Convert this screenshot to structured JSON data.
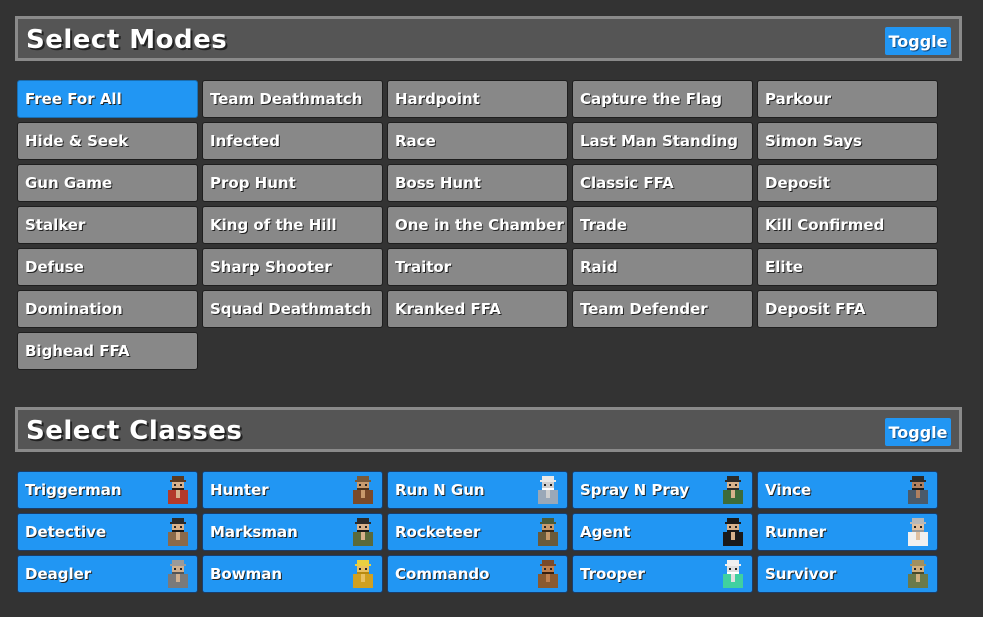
{
  "modes_section": {
    "title": "Select Modes",
    "toggle_label": "Toggle",
    "selected_index": 0,
    "items": [
      "Free For All",
      "Team Deathmatch",
      "Hardpoint",
      "Capture the Flag",
      "Parkour",
      "Hide & Seek",
      "Infected",
      "Race",
      "Last Man Standing",
      "Simon Says",
      "Gun Game",
      "Prop Hunt",
      "Boss Hunt",
      "Classic FFA",
      "Deposit",
      "Stalker",
      "King of the Hill",
      "One in the Chamber",
      "Trade",
      "Kill Confirmed",
      "Defuse",
      "Sharp Shooter",
      "Traitor",
      "Raid",
      "Elite",
      "Domination",
      "Squad Deathmatch",
      "Kranked FFA",
      "Team Defender",
      "Deposit FFA",
      "Bighead FFA"
    ]
  },
  "classes_section": {
    "title": "Select Classes",
    "toggle_label": "Toggle",
    "items": [
      {
        "label": "Triggerman",
        "icon": "triggerman-avatar-icon"
      },
      {
        "label": "Hunter",
        "icon": "hunter-avatar-icon"
      },
      {
        "label": "Run N Gun",
        "icon": "run-n-gun-avatar-icon"
      },
      {
        "label": "Spray N Pray",
        "icon": "spray-n-pray-avatar-icon"
      },
      {
        "label": "Vince",
        "icon": "vince-avatar-icon"
      },
      {
        "label": "Detective",
        "icon": "detective-avatar-icon"
      },
      {
        "label": "Marksman",
        "icon": "marksman-avatar-icon"
      },
      {
        "label": "Rocketeer",
        "icon": "rocketeer-avatar-icon"
      },
      {
        "label": "Agent",
        "icon": "agent-avatar-icon"
      },
      {
        "label": "Runner",
        "icon": "runner-avatar-icon"
      },
      {
        "label": "Deagler",
        "icon": "deagler-avatar-icon"
      },
      {
        "label": "Bowman",
        "icon": "bowman-avatar-icon"
      },
      {
        "label": "Commando",
        "icon": "commando-avatar-icon"
      },
      {
        "label": "Trooper",
        "icon": "trooper-avatar-icon"
      },
      {
        "label": "Survivor",
        "icon": "survivor-avatar-icon"
      }
    ]
  },
  "colors": {
    "background": "#333333",
    "tile_grey": "#888888",
    "accent_blue": "#2196f3"
  }
}
